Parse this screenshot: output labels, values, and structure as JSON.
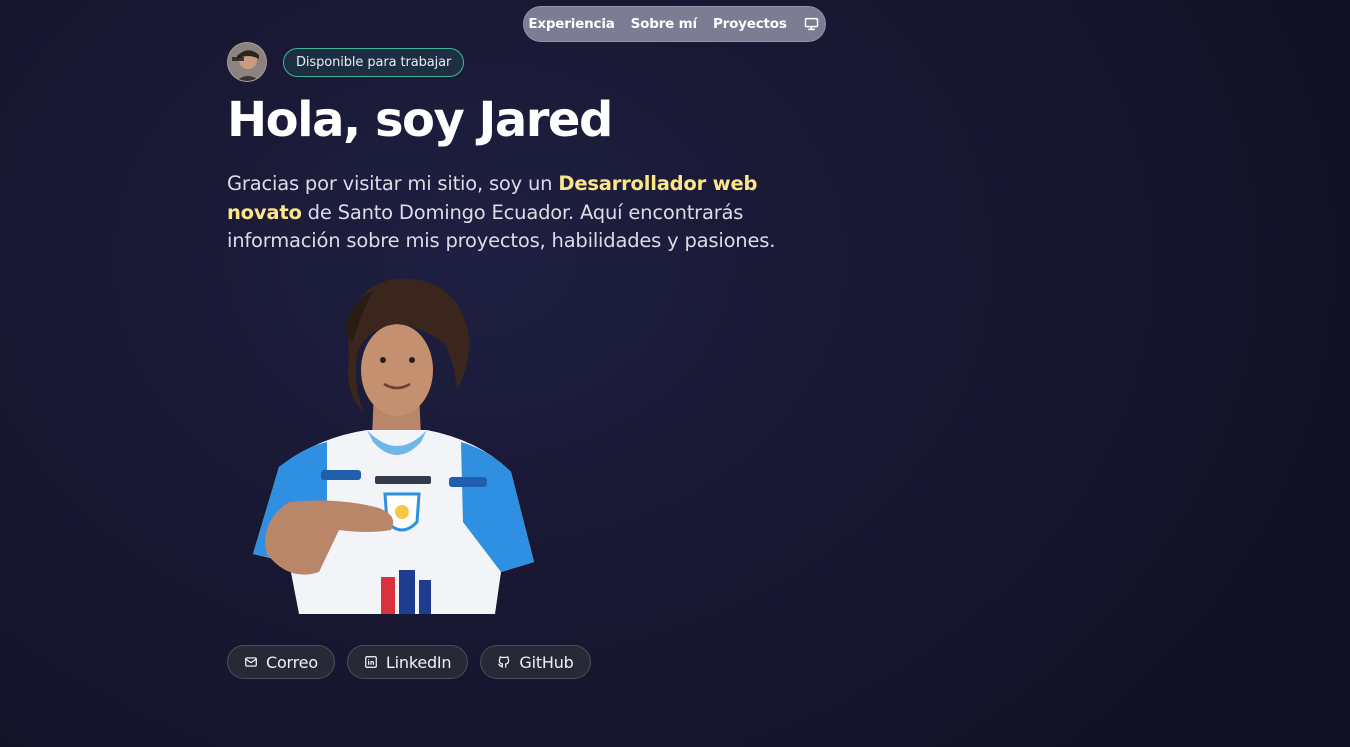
{
  "nav": {
    "items": [
      {
        "label": "Experiencia"
      },
      {
        "label": "Sobre mí"
      },
      {
        "label": "Proyectos"
      }
    ],
    "theme_icon": "monitor-icon"
  },
  "profile": {
    "badge": "Disponible para trabajar",
    "title": "Hola, soy Jared",
    "intro_before": "Gracias por visitar mi sitio, soy un ",
    "intro_highlight": "Desarrollador web novato",
    "intro_after": " de Santo Domingo Ecuador. Aquí encontrarás información sobre mis proyectos, habilidades y pasiones."
  },
  "links": [
    {
      "label": "Correo",
      "icon": "mail-icon"
    },
    {
      "label": "LinkedIn",
      "icon": "linkedin-icon"
    },
    {
      "label": "GitHub",
      "icon": "github-icon"
    }
  ],
  "colors": {
    "highlight": "#fde58a",
    "badge_border": "#3fb59b",
    "background": "#181833"
  }
}
